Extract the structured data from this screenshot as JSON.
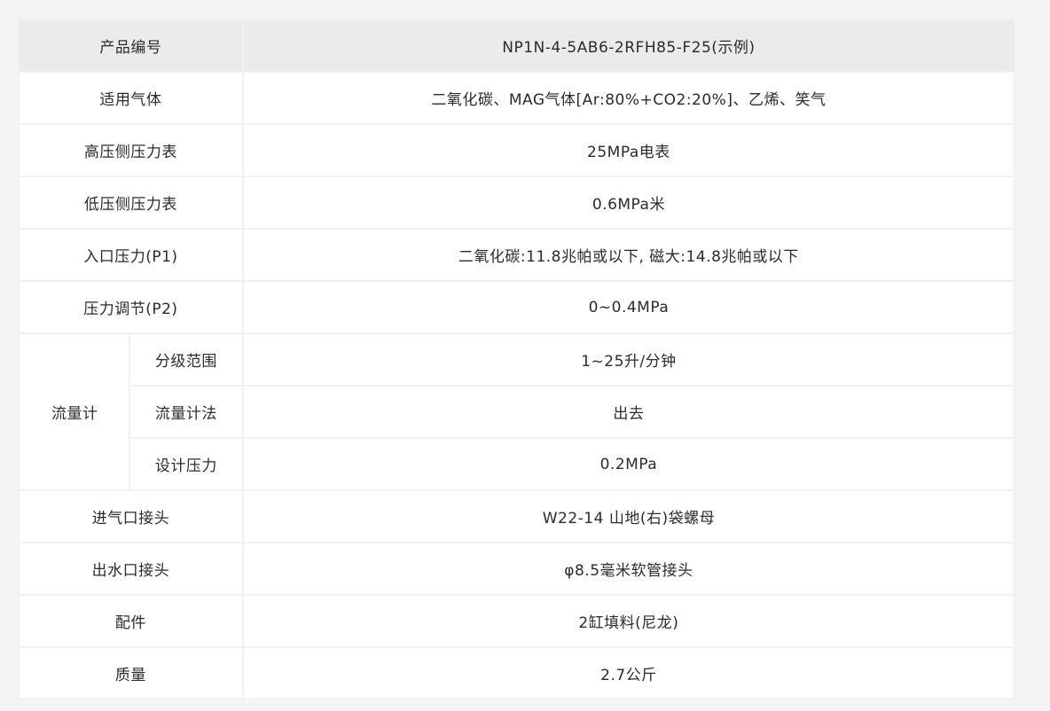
{
  "table": {
    "header": {
      "label": "产品编号",
      "value": "NP1N-4-5AB6-2RFH85-F25(示例)"
    },
    "rows": [
      {
        "label": "适用气体",
        "value": "二氧化碳、MAG气体[Ar:80%+CO2:20%]、乙烯、笑气"
      },
      {
        "label": "高压侧压力表",
        "value": "25MPa电表"
      },
      {
        "label": "低压侧压力表",
        "value": "0.6MPa米"
      },
      {
        "label": "入口压力(P1)",
        "value": "二氧化碳:11.8兆帕或以下, 磁大:14.8兆帕或以下"
      },
      {
        "label": "压力调节(P2)",
        "value": "0~0.4MPa"
      }
    ],
    "flowmeter": {
      "label": "流量计",
      "items": [
        {
          "label": "分级范围",
          "value": "1~25升/分钟"
        },
        {
          "label": "流量计法",
          "value": "出去"
        },
        {
          "label": "设计压力",
          "value": "0.2MPa"
        }
      ]
    },
    "rows_after": [
      {
        "label": "进气口接头",
        "value": "W22-14 山地(右)袋螺母"
      },
      {
        "label": "出水口接头",
        "value": "φ8.5毫米软管接头"
      },
      {
        "label": "配件",
        "value": "2缸填料(尼龙)"
      },
      {
        "label": "质量",
        "value": "2.7公斤"
      }
    ]
  }
}
